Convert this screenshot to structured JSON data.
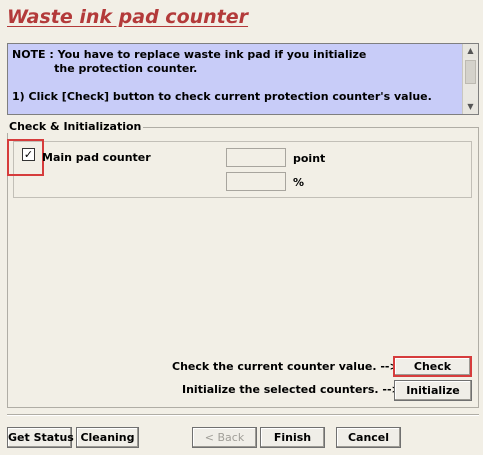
{
  "header": {
    "title": "Waste ink pad counter"
  },
  "note": {
    "text": "NOTE : You have to replace waste ink pad if you initialize\n           the protection counter.\n\n1) Click [Check] button to check current protection counter's value."
  },
  "group": {
    "label": "Check & Initialization",
    "counter": {
      "checked": true,
      "check_mark": "✓",
      "label": "Main pad counter",
      "point_value": "",
      "percent_value": "",
      "unit_point": "point",
      "unit_percent": "%"
    },
    "check_instruction": "Check the current counter value. -->",
    "init_instruction": "Initialize the selected counters. -->",
    "check_label": "Check",
    "init_label": "Initialize"
  },
  "footer": {
    "get_status_label": "Get Status",
    "cleaning_label": "Cleaning",
    "back_label": "< Back",
    "finish_label": "Finish",
    "cancel_label": "Cancel"
  },
  "colors": {
    "title": "#b33a3a",
    "note_background": "#c8ccf8",
    "highlight": "#d63c3c",
    "window_background": "#f2efe6"
  }
}
